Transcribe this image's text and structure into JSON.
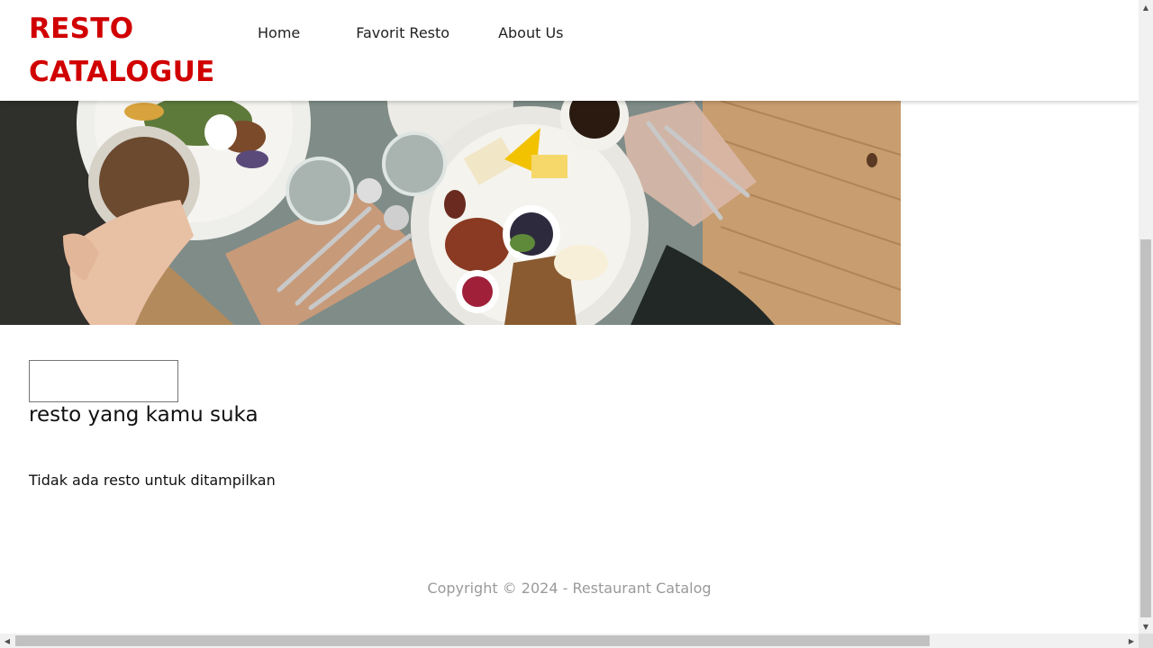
{
  "header": {
    "brand_line1": "RESTO",
    "brand_line2": "CATALOGUE",
    "brand_color": "#d10000",
    "nav": [
      {
        "label": "Home"
      },
      {
        "label": "Favorit Resto"
      },
      {
        "label": "About Us"
      }
    ]
  },
  "hero": {
    "image_icon": "hero-image"
  },
  "main": {
    "search": {
      "value": "",
      "placeholder": ""
    },
    "title": "resto yang kamu suka",
    "empty_message": "Tidak ada resto untuk ditampilkan"
  },
  "footer": {
    "copyright": "Copyright © 2024 - Restaurant Catalog"
  },
  "scrollbars": {
    "up_icon": "▲",
    "down_icon": "▼",
    "left_icon": "◀",
    "right_icon": "▶"
  }
}
